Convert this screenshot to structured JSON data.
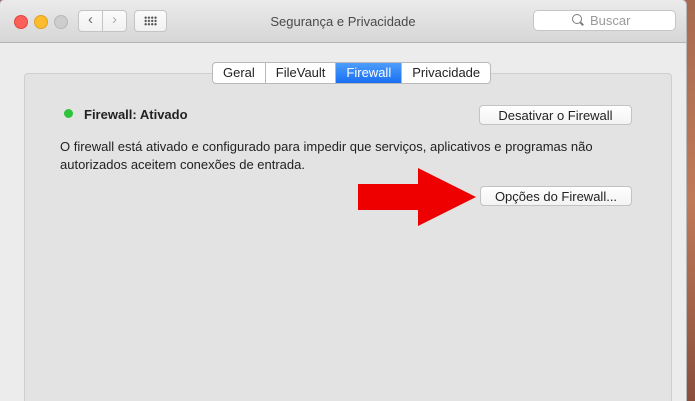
{
  "window": {
    "title": "Segurança e Privacidade"
  },
  "toolbar": {
    "back_icon": "chevron-left-icon",
    "forward_icon": "chevron-right-icon",
    "grid_icon": "grid-icon"
  },
  "search": {
    "placeholder": "Buscar"
  },
  "tabs": [
    {
      "label": "Geral",
      "active": false
    },
    {
      "label": "FileVault",
      "active": false
    },
    {
      "label": "Firewall",
      "active": true
    },
    {
      "label": "Privacidade",
      "active": false
    }
  ],
  "firewall": {
    "status_label": "Firewall: Ativado",
    "status_color": "#2ec33a",
    "toggle_button": "Desativar o Firewall",
    "description": "O firewall está ativado e configurado para impedir que serviços, aplicativos e programas não autorizados aceitem conexões de entrada.",
    "options_button": "Opções do Firewall..."
  },
  "annotation": {
    "arrow_color": "#ee0000"
  },
  "colors": {
    "accent": "#1a6ff2",
    "close": "#fc5f57",
    "minimize": "#fdbc2e"
  }
}
